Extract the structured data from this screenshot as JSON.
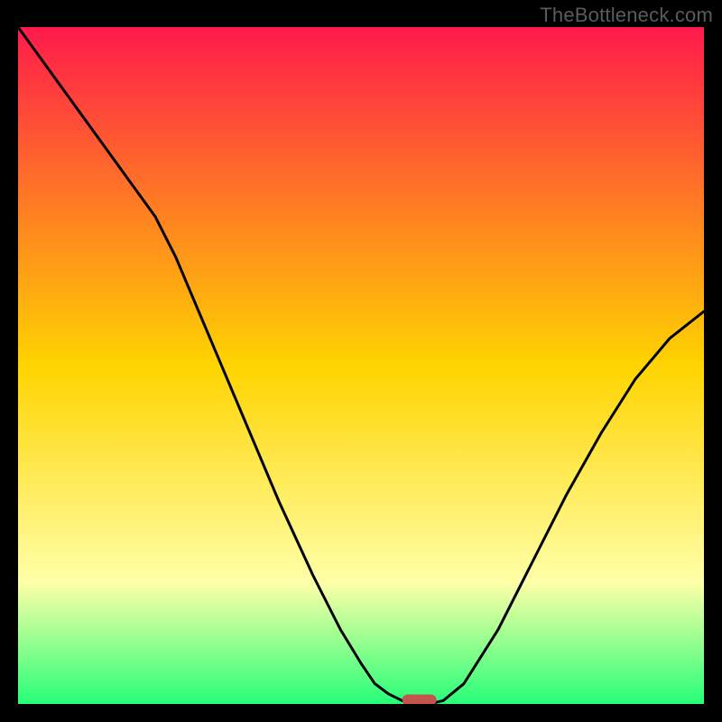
{
  "watermark": "TheBottleneck.com",
  "colors": {
    "gradient_top": "#ff1a4b",
    "gradient_mid": "#ffd400",
    "gradient_low": "#ffffa7",
    "gradient_bottom": "#27ff78",
    "curve": "#000000",
    "marker": "#c4544e"
  },
  "chart_data": {
    "type": "line",
    "title": "",
    "xlabel": "",
    "ylabel": "",
    "xlim": [
      0,
      100
    ],
    "ylim": [
      0,
      100
    ],
    "curve": {
      "x": [
        0,
        5,
        10,
        15,
        20,
        23,
        28,
        33,
        38,
        43,
        47,
        50,
        52,
        54,
        56,
        57,
        60,
        62,
        65,
        70,
        75,
        80,
        85,
        90,
        95,
        100,
        100
      ],
      "y": [
        100,
        93,
        86,
        79,
        72,
        66,
        54,
        42,
        30,
        19,
        11,
        6,
        3,
        1.5,
        0.5,
        0,
        0,
        0.5,
        3,
        11,
        21,
        31,
        40,
        48,
        54,
        58,
        58
      ]
    },
    "marker": {
      "x0": 56,
      "x1": 61,
      "y": 0.6
    }
  }
}
